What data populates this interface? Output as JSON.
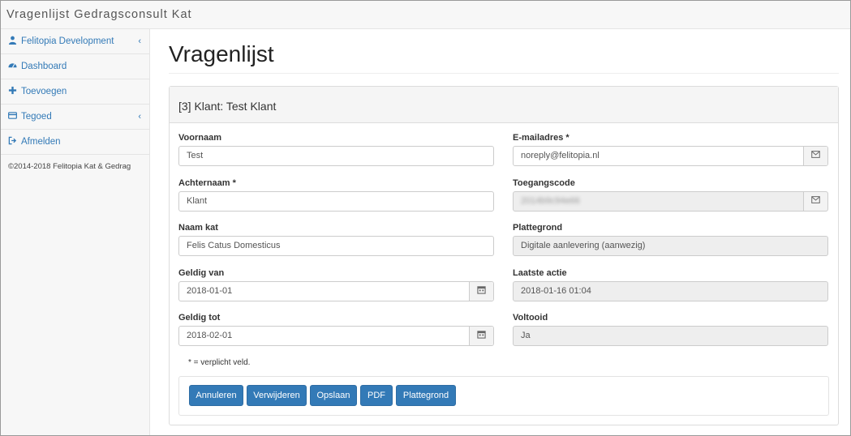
{
  "app": {
    "title": "Vragenlijst Gedragsconsult Kat"
  },
  "sidebar": {
    "items": [
      {
        "label": "Felitopia Development",
        "icon": "user-icon",
        "has_chevron": true
      },
      {
        "label": "Dashboard",
        "icon": "dashboard-icon",
        "has_chevron": false
      },
      {
        "label": "Toevoegen",
        "icon": "plus-icon",
        "has_chevron": false
      },
      {
        "label": "Tegoed",
        "icon": "credit-card-icon",
        "has_chevron": true
      },
      {
        "label": "Afmelden",
        "icon": "sign-out-icon",
        "has_chevron": false
      }
    ],
    "copyright": "©2014-2018 Felitopia Kat & Gedrag"
  },
  "main": {
    "title": "Vragenlijst",
    "panel_title": "[3] Klant: Test Klant",
    "fields": {
      "voornaam": {
        "label": "Voornaam",
        "value": "Test"
      },
      "achternaam": {
        "label": "Achternaam *",
        "value": "Klant"
      },
      "naam_kat": {
        "label": "Naam kat",
        "value": "Felis Catus Domesticus"
      },
      "geldig_van": {
        "label": "Geldig van",
        "value": "2018-01-01"
      },
      "geldig_tot": {
        "label": "Geldig tot",
        "value": "2018-02-01"
      },
      "email": {
        "label": "E-mailadres *",
        "value": "noreply@felitopia.nl"
      },
      "toegangscode": {
        "label": "Toegangscode",
        "value": "2014b9c94e66"
      },
      "plattegrond": {
        "label": "Plattegrond",
        "value": "Digitale aanlevering (aanwezig)"
      },
      "laatste_actie": {
        "label": "Laatste actie",
        "value": "2018-01-16 01:04"
      },
      "voltooid": {
        "label": "Voltooid",
        "value": "Ja"
      }
    },
    "required_note": "* = verplicht veld.",
    "buttons": {
      "annuleren": "Annuleren",
      "verwijderen": "Verwijderen",
      "opslaan": "Opslaan",
      "pdf": "PDF",
      "plattegrond": "Plattegrond"
    }
  },
  "colors": {
    "accent": "#337ab7",
    "sidebar_bg": "#f7f7f7",
    "readonly_bg": "#eeeeee"
  }
}
